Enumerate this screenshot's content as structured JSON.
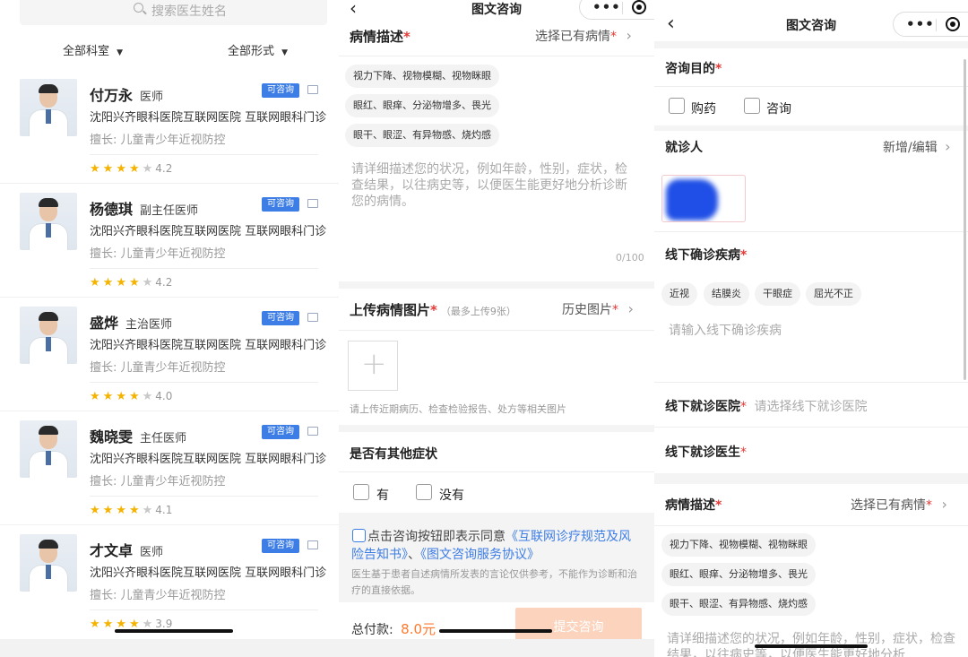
{
  "doctor_list": {
    "search_placeholder": "搜索医生姓名",
    "filters": {
      "department": "全部科室",
      "form": "全部形式"
    },
    "badge": "可咨询",
    "doctors": [
      {
        "name": "付万永",
        "title": "医师",
        "hospital": "沈阳兴齐眼科医院互联网医院 互联网眼科门诊",
        "specialty": "擅长: 儿童青少年近视防控",
        "rating": 4.2,
        "rating_label": "4.2"
      },
      {
        "name": "杨德琪",
        "title": "副主任医师",
        "hospital": "沈阳兴齐眼科医院互联网医院 互联网眼科门诊",
        "specialty": "擅长: 儿童青少年近视防控",
        "rating": 4.2,
        "rating_label": "4.2"
      },
      {
        "name": "盛烨",
        "title": "主治医师",
        "hospital": "沈阳兴齐眼科医院互联网医院 互联网眼科门诊",
        "specialty": "擅长: 儿童青少年近视防控",
        "rating": 4.0,
        "rating_label": "4.0"
      },
      {
        "name": "魏晓雯",
        "title": "主任医师",
        "hospital": "沈阳兴齐眼科医院互联网医院 互联网眼科门诊",
        "specialty": "擅长: 儿童青少年近视防控",
        "rating": 4.1,
        "rating_label": "4.1"
      },
      {
        "name": "才文卓",
        "title": "医师",
        "hospital": "沈阳兴齐眼科医院互联网医院 互联网眼科门诊",
        "specialty": "擅长: 儿童青少年近视防控",
        "rating": 3.9,
        "rating_label": "3.9"
      }
    ]
  },
  "consult_a": {
    "nav_title": "图文咨询",
    "back": "<",
    "condition_label": "病情描述",
    "required": "*",
    "select_existing": "选择已有病情",
    "symptom_tags": [
      "视力下降、视物模糊、视物眯眼",
      "眼红、眼痒、分泌物增多、畏光",
      "眼干、眼涩、有异物感、烧灼感"
    ],
    "description_placeholder": "请详细描述您的状况，例如年龄，性别，症状，检查结果，以往病史等，以便医生能更好地分析诊断您的病情。",
    "char_count": "0/100",
    "upload_label": "上传病情图片",
    "upload_hint": "（最多上传9张）",
    "history_images": "历史图片",
    "upload_plus": "+",
    "upload_note": "请上传近期病历、检查检验报告、处方等相关图片",
    "other_symptoms_label": "是否有其他症状",
    "option_yes": "有",
    "option_no": "没有",
    "agree_prefix": "点击咨询按钮即表示同意",
    "agree_link1": "《互联网诊疗规范及风险告知书》",
    "agree_sep": "、",
    "agree_link2": "《图文咨询服务协议》",
    "disclaimer": "医生基于患者自述病情所发表的言论仅供参考，不能作为诊断和治疗的直接依据。",
    "total_label": "总付款:",
    "total_amount": "8.0元",
    "submit_label": "提交咨询"
  },
  "consult_b": {
    "nav_title": "图文咨询",
    "back": "<",
    "purpose_label": "咨询目的",
    "required": "*",
    "purpose_options": [
      "购药",
      "咨询"
    ],
    "patient_label": "就诊人",
    "patient_action": "新增/编辑",
    "diagnosis_label": "线下确诊疾病",
    "diagnosis_tags": [
      "近视",
      "结膜炎",
      "干眼症",
      "屈光不正"
    ],
    "diagnosis_placeholder": "请输入线下确诊疾病",
    "hospital_label": "线下就诊医院",
    "hospital_placeholder": "请选择线下就诊医院",
    "doctor_label": "线下就诊医生",
    "condition_label": "病情描述",
    "select_existing": "选择已有病情",
    "symptom_tags": [
      "视力下降、视物模糊、视物眯眼",
      "眼红、眼痒、分泌物增多、畏光",
      "眼干、眼涩、有异物感、烧灼感"
    ],
    "description_placeholder": "请详细描述您的状况，例如年龄，性别，症状，检查结果，以往病史等，以便医生能更好地分析"
  },
  "colors": {
    "accent_blue": "#3c7de6",
    "required_red": "#e53935",
    "price_orange": "#ff7a2e",
    "submit_disabled": "#fcd3bd",
    "star": "#f5b301"
  },
  "icons": [
    "search-icon",
    "chevron-down-icon",
    "image-icon",
    "star-icon",
    "back-icon",
    "more-icon",
    "target-icon",
    "chevron-right-icon",
    "plus-icon",
    "checkbox-icon"
  ]
}
